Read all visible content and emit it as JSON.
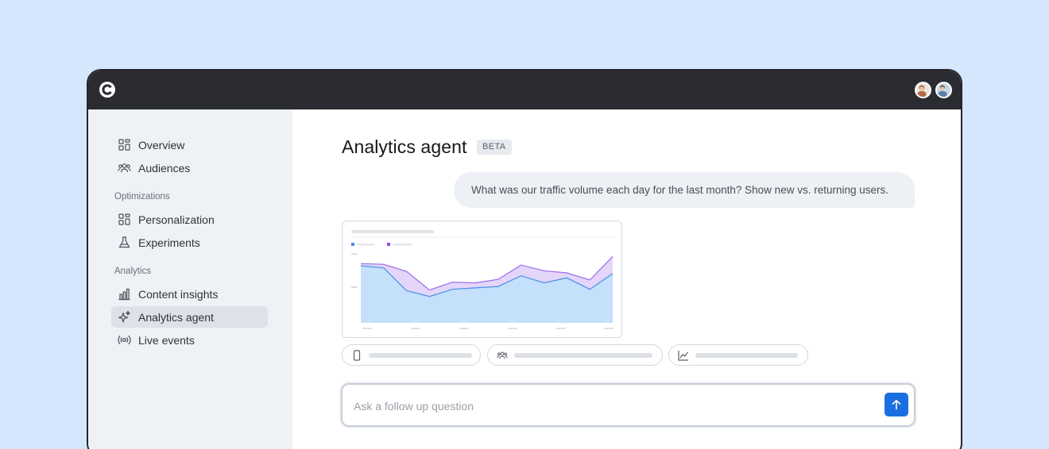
{
  "window": {
    "logo_icon": "contentsquare-c-logo"
  },
  "header": {
    "avatars": [
      {
        "name": "user-avatar-1"
      },
      {
        "name": "user-avatar-2"
      }
    ]
  },
  "sidebar": {
    "items_top": [
      {
        "label": "Overview",
        "icon": "grid-icon"
      },
      {
        "label": "Audiences",
        "icon": "people-icon"
      }
    ],
    "sections": [
      {
        "label": "Optimizations",
        "items": [
          {
            "label": "Personalization",
            "icon": "grid-icon"
          },
          {
            "label": "Experiments",
            "icon": "flask-icon"
          }
        ]
      },
      {
        "label": "Analytics",
        "items": [
          {
            "label": "Content insights",
            "icon": "bar-chart-icon"
          },
          {
            "label": "Analytics agent",
            "icon": "sparkle-icon",
            "active": true
          },
          {
            "label": "Live events",
            "icon": "broadcast-icon"
          }
        ]
      }
    ]
  },
  "main": {
    "title": "Analytics agent",
    "badge": "BETA",
    "user_message": "What was our traffic volume each day for the last month? Show new vs. returning users.",
    "input": {
      "placeholder": "Ask a follow up question"
    }
  },
  "colors": {
    "accent": "#1a6fe0",
    "series_new": "#c4e0fb",
    "series_returning": "#e3d6fa",
    "line_new": "#4a90e2",
    "line_returning": "#9a6ae8"
  },
  "chart_data": {
    "type": "area",
    "title": "",
    "xlabel": "",
    "ylabel": "",
    "series": [
      {
        "values": [
          80,
          77,
          45,
          37,
          47,
          49,
          51,
          66,
          56,
          63,
          47,
          69
        ]
      },
      {
        "values": [
          83,
          82,
          72,
          46,
          57,
          56,
          61,
          81,
          73,
          70,
          60,
          93
        ]
      }
    ]
  }
}
